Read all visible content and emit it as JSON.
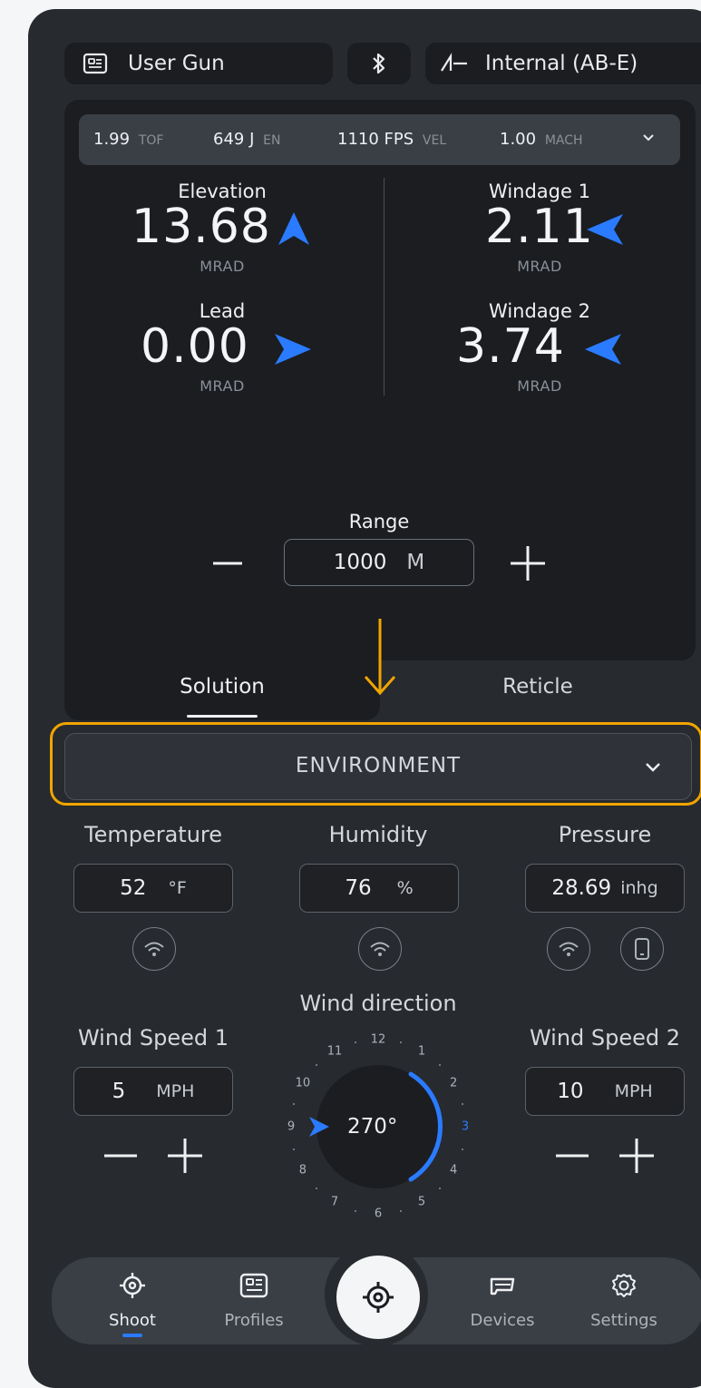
{
  "top_bar": {
    "gun_label": "User Gun",
    "device_label": "Internal (AB-E)"
  },
  "stats": [
    {
      "value": "1.99",
      "unit": "TOF"
    },
    {
      "value": "649 J",
      "unit": "EN"
    },
    {
      "value": "1110 FPS",
      "unit": "VEL"
    },
    {
      "value": "1.00",
      "unit": "MACH"
    }
  ],
  "solution": {
    "elevation": {
      "label": "Elevation",
      "value": "13.68",
      "unit": "MRAD"
    },
    "windage1": {
      "label": "Windage 1",
      "value": "2.11",
      "unit": "MRAD"
    },
    "lead": {
      "label": "Lead",
      "value": "0.00",
      "unit": "MRAD"
    },
    "windage2": {
      "label": "Windage 2",
      "value": "3.74",
      "unit": "MRAD"
    },
    "range": {
      "label": "Range",
      "value": "1000",
      "unit": "M"
    }
  },
  "tabs": [
    {
      "label": "Solution"
    },
    {
      "label": "Reticle"
    }
  ],
  "environment": {
    "title": "ENVIRONMENT",
    "temperature": {
      "label": "Temperature",
      "value": "52",
      "unit": "°F"
    },
    "humidity": {
      "label": "Humidity",
      "value": "76",
      "unit": "%"
    },
    "pressure": {
      "label": "Pressure",
      "value": "28.69",
      "unit": "inhg"
    }
  },
  "wind": {
    "direction_label": "Wind direction",
    "direction_value": "270°",
    "speed1": {
      "label": "Wind Speed 1",
      "value": "5",
      "unit": "MPH"
    },
    "speed2": {
      "label": "Wind Speed 2",
      "value": "10",
      "unit": "MPH"
    },
    "dial_numbers": [
      "12",
      "1",
      "2",
      "3",
      "4",
      "5",
      "6",
      "7",
      "8",
      "9",
      "10",
      "11"
    ],
    "active_hour": "3"
  },
  "nav": [
    {
      "label": "Shoot",
      "icon": "crosshair-icon"
    },
    {
      "label": "Profiles",
      "icon": "id-card-icon"
    },
    {
      "label": "Devices",
      "icon": "device-icon"
    },
    {
      "label": "Settings",
      "icon": "gear-icon"
    }
  ],
  "colors": {
    "accent_blue": "#2a7bff",
    "highlight_orange": "#f0a500",
    "background": "#272a2f",
    "panel": "#1b1d21"
  }
}
